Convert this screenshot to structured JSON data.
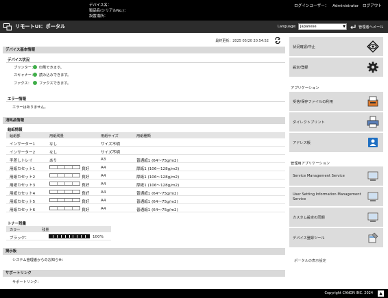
{
  "header": {
    "device_name_label": "デバイス名：",
    "product_name_label": "製品名(シリアルNo.)：",
    "location_label": "設置場所：",
    "login_user_label": "ログインユーザー：",
    "login_user": "Administrator",
    "logout": "ログアウト"
  },
  "titlebar": {
    "title": "リモートUI：ポータル",
    "language_label": "Language:",
    "language_value": "Japanese",
    "mail_link": "管理者へメール"
  },
  "status": {
    "last_updated": "最終更新：2025 05/20 20:54:52"
  },
  "device_basic": {
    "section_title": "デバイス基本情報",
    "status_heading": "デバイス状況",
    "items": [
      {
        "label": "プリンター：",
        "value": "印刷できます。"
      },
      {
        "label": "スキャナー：",
        "value": "読み込みできます。"
      },
      {
        "label": "ファクス：",
        "value": "ファクスできます。"
      }
    ],
    "error_heading": "エラー情報",
    "error_text": "エラーはありません。"
  },
  "consumables": {
    "section_title": "消耗品情報",
    "paper_heading": "給紙情報",
    "columns": [
      "給紙部",
      "用紙残量",
      "用紙サイズ",
      "用紙種類"
    ],
    "rows": [
      {
        "source": "インサーター1",
        "remaining": "なし",
        "size": "サイズ不明",
        "type": "",
        "bar": false
      },
      {
        "source": "インサーター2",
        "remaining": "なし",
        "size": "サイズ不明",
        "type": "",
        "bar": false
      },
      {
        "source": "手差しトレイ",
        "remaining": "あり",
        "size": "A3",
        "type": "普通紙1 (64〜75g/m2)",
        "bar": false
      },
      {
        "source": "用紙カセット1",
        "remaining": "良好",
        "size": "A4",
        "type": "厚紙1 (106〜128g/m2)",
        "bar": true
      },
      {
        "source": "用紙カセット2",
        "remaining": "良好",
        "size": "A4",
        "type": "厚紙1 (106〜128g/m2)",
        "bar": true
      },
      {
        "source": "用紙カセット3",
        "remaining": "良好",
        "size": "A4",
        "type": "厚紙1 (106〜128g/m2)",
        "bar": true
      },
      {
        "source": "用紙カセット4",
        "remaining": "良好",
        "size": "A4",
        "type": "普通紙1 (64〜75g/m2)",
        "bar": true
      },
      {
        "source": "用紙カセット5",
        "remaining": "良好",
        "size": "A4",
        "type": "普通紙1 (64〜75g/m2)",
        "bar": true
      },
      {
        "source": "用紙カセット6",
        "remaining": "良好",
        "size": "A4",
        "type": "普通紙1 (64〜75g/m2)",
        "bar": true
      }
    ],
    "toner_heading": "トナー残量",
    "toner_columns": [
      "カラー",
      "残量"
    ],
    "toner": {
      "color": "ブラック：",
      "level_text": "100%",
      "level_percent": 100
    }
  },
  "bulletin": {
    "section_title": "掲示板",
    "text": "システム管理者からのお知らせ："
  },
  "support": {
    "section_title": "サポートリンク",
    "text": "サポートリンク："
  },
  "sidebar": {
    "buttons": [
      {
        "label": "状況確認/中止",
        "icon": "eye-icon"
      },
      {
        "label": "設定/登録",
        "icon": "gear-icon"
      }
    ],
    "apps_heading": "アプリケーション",
    "apps": [
      {
        "label": "受信/保存ファイルの利用",
        "icon": "inbox-icon"
      },
      {
        "label": "ダイレクトプリント",
        "icon": "printer-icon"
      },
      {
        "label": "アドレス帳",
        "icon": "address-book-icon"
      }
    ],
    "mgmt_heading": "管理用アプリケーション",
    "mgmt": [
      {
        "label": "Service Management Service",
        "icon": "monitor-icon"
      },
      {
        "label": "User Setting Information Management Service",
        "icon": "monitor-icon"
      },
      {
        "label": "カスタム設定の同期",
        "icon": "monitor-icon"
      },
      {
        "label": "デバイス登録ツール",
        "icon": "device-tool-icon"
      }
    ],
    "portal_display_settings": "ポータルの表示設定"
  },
  "footer": {
    "copyright": "Copyright CANON INC. 2024"
  },
  "colors": {
    "topbar": "#000000",
    "titlebar": "#2c2c2c",
    "section_bar": "#d9d9d9",
    "side_button": "#dcdcdc",
    "status_ok": "#3fae49"
  }
}
